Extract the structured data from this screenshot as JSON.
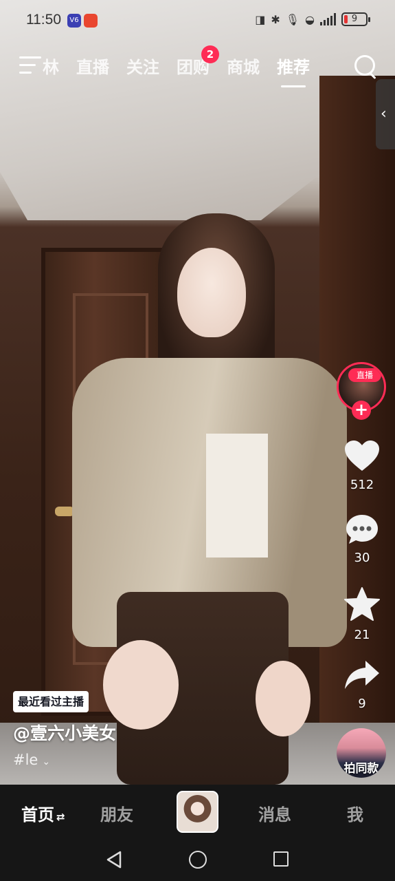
{
  "status_bar": {
    "time": "11:50",
    "app_icon_1": "V6",
    "app_icon_2": "app",
    "battery": "9"
  },
  "top_nav": {
    "tabs": [
      {
        "label": "林"
      },
      {
        "label": "直播"
      },
      {
        "label": "关注"
      },
      {
        "label": "团购",
        "badge": "2"
      },
      {
        "label": "商城"
      },
      {
        "label": "推荐",
        "active": true
      }
    ]
  },
  "side_drawer": {
    "glyph": "‹"
  },
  "actions": {
    "live_tag": "直播",
    "follow_plus": "+",
    "likes": "512",
    "comments": "30",
    "favorites": "21",
    "shares": "9",
    "same_style": "拍同款"
  },
  "video_info": {
    "recent_badge": "最近看过主播",
    "author": "@壹六小美女",
    "hashtag": "#le",
    "expand": "⌄"
  },
  "bottom_nav": {
    "home": "首页",
    "home_swap": "⇄",
    "friends": "朋友",
    "messages": "消息",
    "me": "我"
  },
  "colors": {
    "accent": "#fe2c55",
    "bar_bg": "#161616"
  },
  "icons": [
    "menu-icon",
    "search-icon",
    "heart-icon",
    "comment-icon",
    "star-icon",
    "share-icon",
    "back-icon",
    "home-icon",
    "recent-apps-icon"
  ]
}
